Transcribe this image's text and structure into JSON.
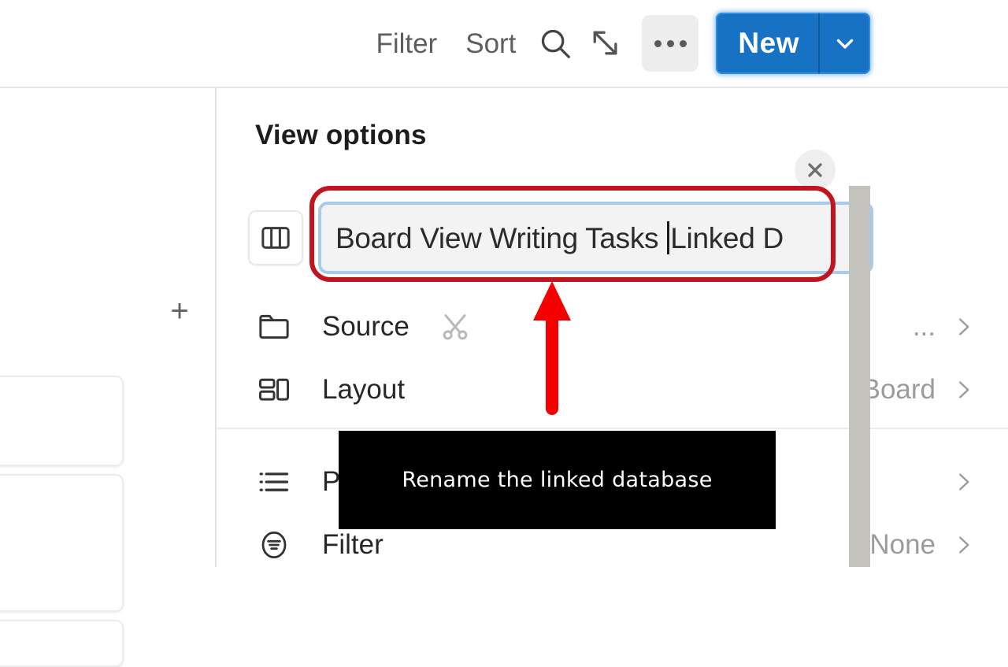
{
  "toolbar": {
    "filter_label": "Filter",
    "sort_label": "Sort",
    "search_icon": "search-icon",
    "expand_icon": "expand-diagonal-icon",
    "more_icon": "ellipsis-icon",
    "new_label": "New",
    "new_caret_icon": "chevron-down-icon",
    "accent_color": "#1872c4"
  },
  "board": {
    "add_column_label": "+"
  },
  "panel": {
    "title": "View options",
    "close_icon": "close-icon",
    "name_row": {
      "view_type_icon": "board-columns-icon",
      "input_text_before_caret": "Board View Writing Tasks ",
      "input_text_after_caret": "Linked D"
    },
    "rows": [
      {
        "icon": "folder-icon",
        "label": "Source",
        "extra_icon": "scissors-icon",
        "value": "...",
        "chevron": "chevron-right-icon"
      },
      {
        "icon": "layout-grid-icon",
        "label": "Layout",
        "extra_icon": "",
        "value": "Board",
        "chevron": "chevron-right-icon"
      },
      {
        "icon": "list-bullet-icon",
        "label": "P",
        "extra_icon": "",
        "value": "",
        "chevron": "chevron-right-icon"
      },
      {
        "icon": "filter-circle-icon",
        "label": "Filter",
        "extra_icon": "",
        "value": "None",
        "chevron": "chevron-right-icon"
      }
    ]
  },
  "annotation": {
    "highlight_color": "#c0141e",
    "arrow_color": "#f40000",
    "arrow_name": "up-arrow-annotation",
    "caption": "Rename the linked database"
  }
}
